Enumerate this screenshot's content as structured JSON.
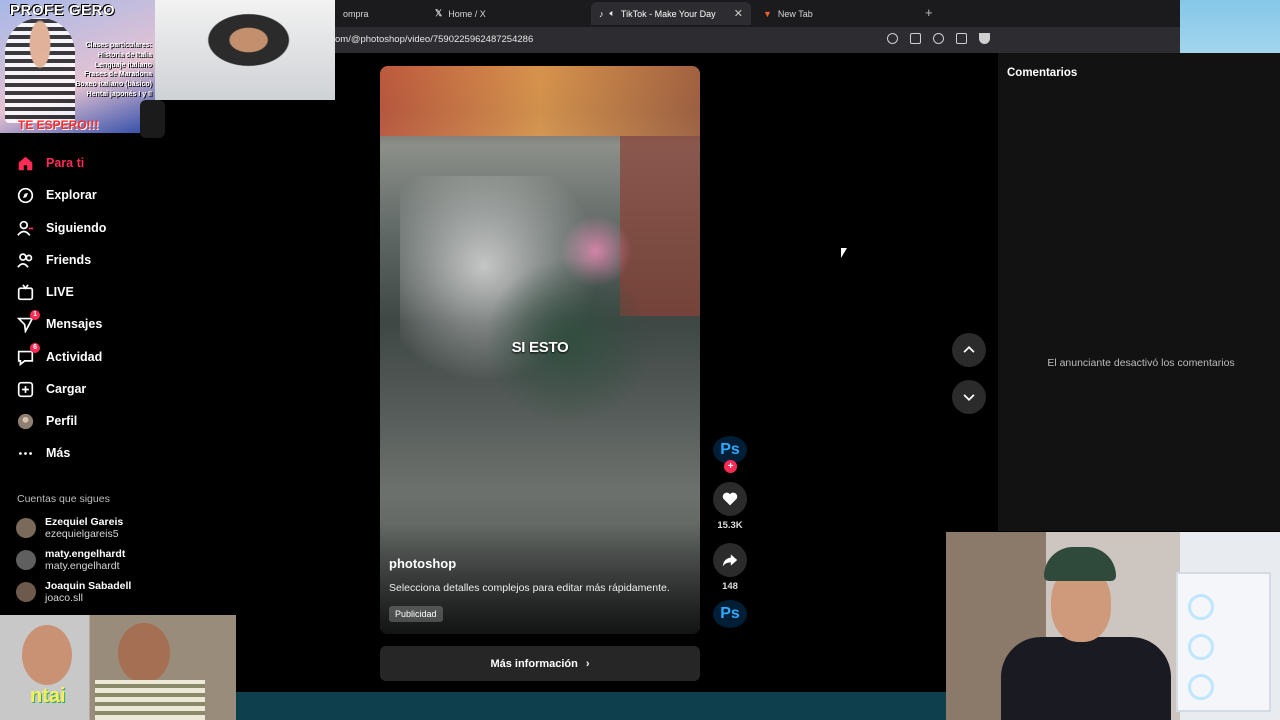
{
  "browser": {
    "tabs": [
      {
        "label": "ompra"
      },
      {
        "label": "Home / X"
      },
      {
        "label": "TikTok - Make Your Day"
      },
      {
        "label": "New Tab"
      }
    ],
    "url": "om/@photoshop/video/7590225962487254286"
  },
  "sidebar": {
    "items": [
      {
        "label": "Para ti",
        "icon": "home-icon"
      },
      {
        "label": "Explorar",
        "icon": "compass-icon"
      },
      {
        "label": "Siguiendo",
        "icon": "following-icon"
      },
      {
        "label": "Friends",
        "icon": "friends-icon"
      },
      {
        "label": "LIVE",
        "icon": "live-icon"
      },
      {
        "label": "Mensajes",
        "icon": "messages-icon",
        "badge": "1"
      },
      {
        "label": "Actividad",
        "icon": "activity-icon",
        "badge": "6"
      },
      {
        "label": "Cargar",
        "icon": "upload-icon"
      },
      {
        "label": "Perfil",
        "icon": "profile-icon"
      },
      {
        "label": "Más",
        "icon": "more-icon"
      }
    ],
    "following_title": "Cuentas que sigues",
    "accounts": [
      {
        "name": "Ezequiel Gareis",
        "username": "ezequielgareis5"
      },
      {
        "name": "maty.engelhardt",
        "username": "maty.engelhardt"
      },
      {
        "name": "Joaquin Sabadell",
        "username": "joaco.sll"
      }
    ]
  },
  "video": {
    "caption": "SI ESTO",
    "author": "photoshop",
    "description": "Selecciona detalles complejos para editar más rápidamente.",
    "ad_label": "Publicidad",
    "more_info": "Más información"
  },
  "actions": {
    "brand_icon": "Ps",
    "likes": "15.3K",
    "shares": "148"
  },
  "comments": {
    "title": "Comentarios",
    "disabled_message": "El anunciante desactivó los comentarios"
  },
  "overlay": {
    "header": "PROFE GERO",
    "lines": [
      "Clases particulares:",
      "Historia de Italia",
      "Lenguaje italiano",
      "Frases de Maradona",
      "Boxeo italiano (básico)",
      "Hentai japonés I y II"
    ],
    "cta": "TE ESPERO!!!",
    "cam_text": "ntai"
  },
  "colors": {
    "accent": "#fe2c55",
    "panel": "#121212",
    "button": "#262626"
  }
}
